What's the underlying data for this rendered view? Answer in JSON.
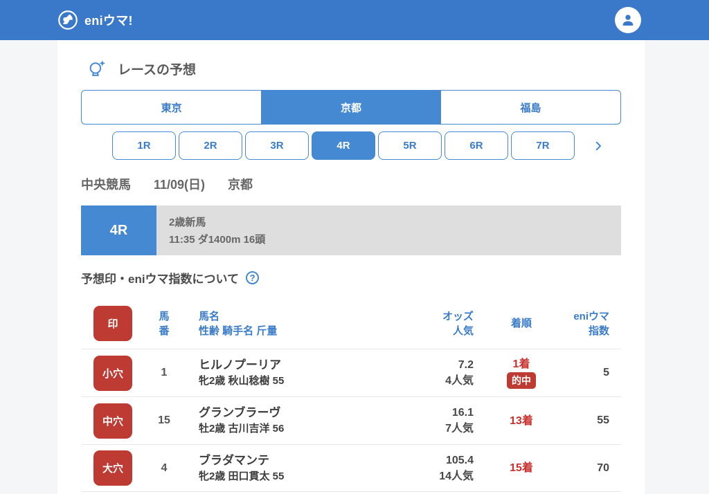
{
  "colors": {
    "brand_blue": "#3A79C9",
    "accent_blue": "#4489D2",
    "link_blue": "#3B7CC9",
    "badge_red": "#BE3B33",
    "result_red": "#C9302C",
    "race_info_gray": "#DEDEDE",
    "page_bg": "#F5F6F8"
  },
  "header": {
    "brand": "eniウマ!",
    "logo_icon": "horse-head-in-circle",
    "avatar_icon": "person"
  },
  "main": {
    "section_title": "レースの予想",
    "section_icon": "crystal-ball",
    "venue_tabs": [
      {
        "label": "東京",
        "selected": false
      },
      {
        "label": "京都",
        "selected": true
      },
      {
        "label": "福島",
        "selected": false
      }
    ],
    "race_tabs": [
      {
        "label": "1R",
        "selected": false
      },
      {
        "label": "2R",
        "selected": false
      },
      {
        "label": "3R",
        "selected": false
      },
      {
        "label": "4R",
        "selected": true
      },
      {
        "label": "5R",
        "selected": false
      },
      {
        "label": "6R",
        "selected": false
      },
      {
        "label": "7R",
        "selected": false
      }
    ],
    "race_meta": {
      "organization": "中央競馬",
      "date": "11/09(日)",
      "venue": "京都"
    },
    "race_info": {
      "race_no": "4R",
      "race_name": "2歳新馬",
      "race_details": "11:35 ダ1400m 16頭"
    },
    "about_heading": "予想印・eniウマ指数について",
    "help_glyph": "?",
    "table": {
      "header": {
        "mark": "印",
        "number_line1": "馬",
        "number_line2": "番",
        "name_line1": "馬名",
        "name_line2": "性齢  騎手名  斤量",
        "odds_line1": "オッズ",
        "odds_line2": "人気",
        "result": "着順",
        "index_line1": "eniウマ",
        "index_line2": "指数"
      },
      "rows": [
        {
          "mark": "小穴",
          "number": "1",
          "name": "ヒルノプーリア",
          "details": "牝2歳 秋山稔樹 55",
          "odds": "7.2",
          "popularity": "4人気",
          "result": "1着",
          "hit_badge": "的中",
          "index": "5"
        },
        {
          "mark": "中穴",
          "number": "15",
          "name": "グランブラーヴ",
          "details": "牡2歳 古川吉洋 56",
          "odds": "16.1",
          "popularity": "7人気",
          "result": "13着",
          "index": "55"
        },
        {
          "mark": "大穴",
          "number": "4",
          "name": "ブラダマンテ",
          "details": "牝2歳 田口貫太 55",
          "odds": "105.4",
          "popularity": "14人気",
          "result": "15着",
          "index": "70"
        }
      ]
    }
  }
}
